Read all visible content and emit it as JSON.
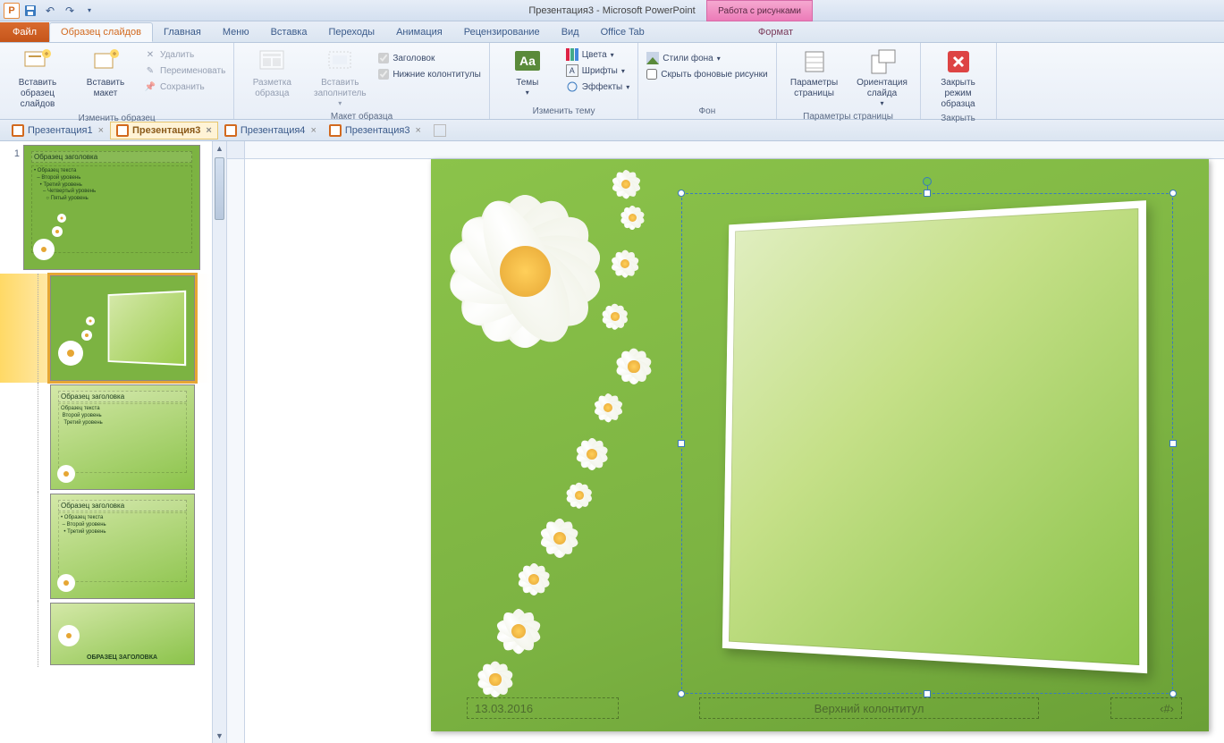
{
  "app": {
    "title": "Презентация3  -  Microsoft PowerPoint",
    "contextual_tab_group": "Работа с рисунками"
  },
  "qat": {
    "save_tip": "Сохранить",
    "undo_tip": "Отменить",
    "redo_tip": "Повторить"
  },
  "tabs": {
    "file": "Файл",
    "slide_master": "Образец слайдов",
    "home": "Главная",
    "menu": "Меню",
    "insert": "Вставка",
    "transitions": "Переходы",
    "animation": "Анимация",
    "review": "Рецензирование",
    "view": "Вид",
    "office_tab": "Office Tab",
    "format": "Формат"
  },
  "ribbon": {
    "edit_master": {
      "label": "Изменить образец",
      "insert_slide_master": "Вставить образец слайдов",
      "insert_layout": "Вставить макет",
      "delete": "Удалить",
      "rename": "Переименовать",
      "preserve": "Сохранить"
    },
    "master_layout": {
      "label": "Макет образца",
      "master_layout_btn": "Разметка образца",
      "insert_placeholder": "Вставить заполнитель",
      "title_chk": "Заголовок",
      "footers_chk": "Нижние колонтитулы"
    },
    "edit_theme": {
      "label": "Изменить тему",
      "themes": "Темы",
      "colors": "Цвета",
      "fonts": "Шрифты",
      "effects": "Эффекты"
    },
    "background": {
      "label": "Фон",
      "background_styles": "Стили фона",
      "hide_bg_graphics": "Скрыть фоновые рисунки"
    },
    "page_setup": {
      "label": "Параметры страницы",
      "page_setup_btn": "Параметры страницы",
      "slide_orientation": "Ориентация слайда"
    },
    "close": {
      "label": "Закрыть",
      "close_master": "Закрыть режим образца"
    }
  },
  "doc_tabs": [
    {
      "label": "Презентация1",
      "active": false
    },
    {
      "label": "Презентация3",
      "active": true
    },
    {
      "label": "Презентация4",
      "active": false
    },
    {
      "label": "Презентация3",
      "active": false
    }
  ],
  "thumbs": {
    "master_index": "1",
    "master_title": "Образец заголовка",
    "bullets": {
      "l1": "Образец текста",
      "l2": "Второй уровень",
      "l3": "Третий уровень",
      "l4": "Четвертый уровень",
      "l5": "Пятый уровень"
    },
    "layout_title": "Образец заголовка",
    "layout_caps": "ОБРАЗЕЦ ЗАГОЛОВКА"
  },
  "slide": {
    "date": "13.03.2016",
    "footer": "Верхний колонтитул",
    "slide_number": "‹#›"
  }
}
